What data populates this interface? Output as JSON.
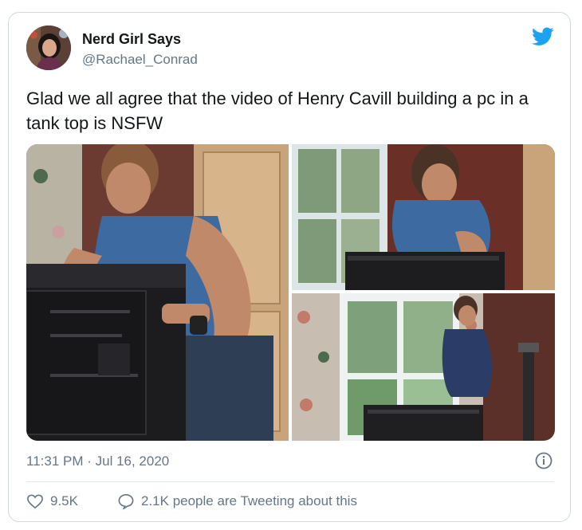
{
  "tweet": {
    "author": {
      "name": "Nerd Girl Says",
      "handle": "@Rachael_Conrad"
    },
    "text": "Glad we all agree that the video of Henry Cavill building a pc in a tank top is NSFW",
    "timestamp": "11:31 PM · Jul 16, 2020",
    "likes": "9.5K",
    "tweeting": "2.1K people are Tweeting about this"
  },
  "icons": {
    "brand": "twitter-bird-icon",
    "info": "info-icon",
    "like": "heart-icon",
    "reply": "speech-bubble-icon"
  },
  "colors": {
    "brand": "#1DA1F2",
    "secondary_text": "#657786",
    "border": "#cfd9de"
  }
}
